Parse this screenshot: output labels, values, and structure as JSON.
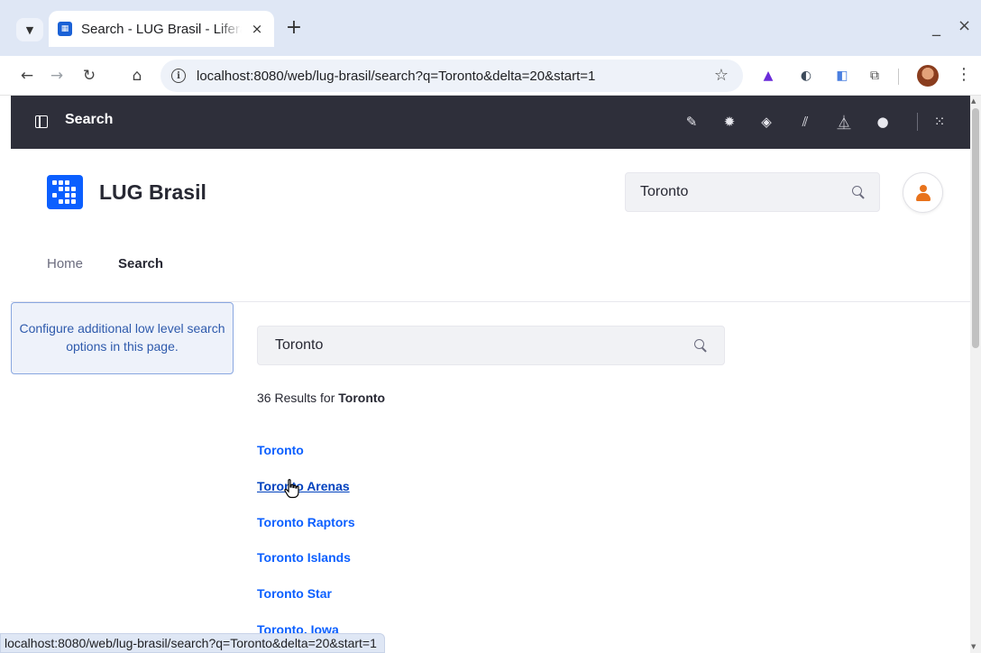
{
  "browser": {
    "tab_title": "Search - LUG Brasil - Liferay",
    "new_tab": "+",
    "tab_close": "×",
    "window_minimize": "_",
    "window_close": "×",
    "url": "localhost:8080/web/lug-brasil/search?q=Toronto&delta=20&start=1",
    "status_url": "localhost:8080/web/lug-brasil/search?q=Toronto&delta=20&start=1"
  },
  "control_menu": {
    "title": "Search",
    "icons": [
      "pencil-icon",
      "gear-icon",
      "globe-icon",
      "analytics-icon",
      "flask-icon",
      "info-icon",
      "apps-grid-icon"
    ]
  },
  "site": {
    "name": "LUG Brasil",
    "header_search_value": "Toronto"
  },
  "nav": {
    "items": [
      {
        "label": "Home",
        "active": false
      },
      {
        "label": "Search",
        "active": true
      }
    ]
  },
  "info_box": {
    "text": "Configure additional low level search options in this page."
  },
  "search": {
    "query": "Toronto",
    "results_prefix": "36 Results for",
    "results_term": "Toronto",
    "results": [
      {
        "title": "Toronto"
      },
      {
        "title": "Toronto Arenas",
        "hovered": true
      },
      {
        "title": "Toronto Raptors"
      },
      {
        "title": "Toronto Islands"
      },
      {
        "title": "Toronto Star"
      },
      {
        "title": "Toronto, Iowa"
      }
    ]
  },
  "colors": {
    "control_menu_bg": "#2e2f3a",
    "link": "#0b5fff",
    "brand": "#0b5fff",
    "avatar": "#e8731c"
  }
}
